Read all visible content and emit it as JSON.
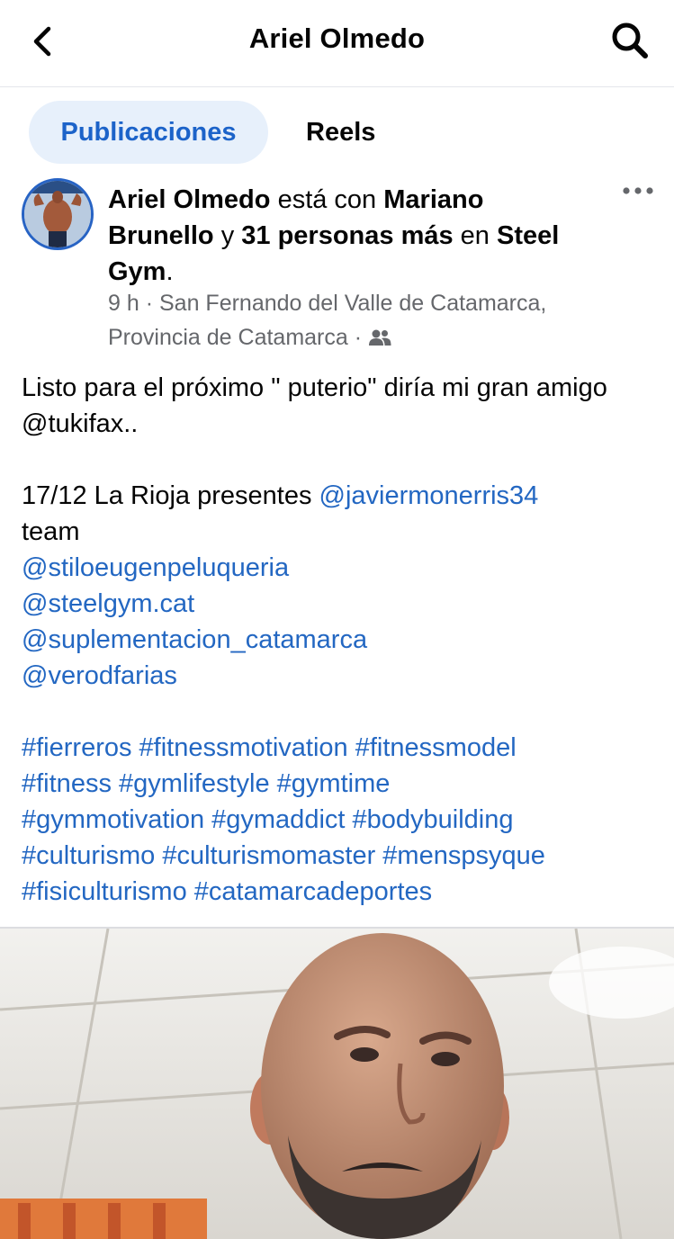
{
  "header": {
    "title": "Ariel Olmedo",
    "back_icon": "chevron-left-icon",
    "search_icon": "search-icon"
  },
  "tabs": [
    {
      "label": "Publicaciones",
      "active": true
    },
    {
      "label": "Reels",
      "active": false
    }
  ],
  "post": {
    "author": "Ariel Olmedo",
    "with_text": "está con",
    "tagged": "Mariano Brunello",
    "connector": "y",
    "others": "31 personas más",
    "in_text": "en",
    "place": "Steel Gym",
    "period": ".",
    "time": "9 h",
    "dot": "·",
    "location": "San Fernando del Valle de Catamarca, Provincia de Catamarca",
    "audience_icon": "friends-icon",
    "more_icon": "more-horizontal-icon",
    "body_line1": "Listo para el próximo \" puterio\" diría mi gran amigo @tukifax..",
    "body_line2_text": "17/12 La Rioja presentes",
    "body_line2_mention": "@javiermonerris34",
    "body_line3": "team",
    "mentions": [
      "@stiloeugenpeluqueria",
      "@steelgym.cat",
      "@suplementacion_catamarca",
      "@verodfarias"
    ],
    "hashtag_lines": [
      "#fierreros #fitnessmotivation #fitnessmodel",
      "#fitness #gymlifestyle #gymtime",
      "#gymmotivation #gymaddict #bodybuilding",
      "#culturismo #culturismomaster #menspsyque",
      "#fisiculturismo #catamarcadeportes"
    ]
  },
  "colors": {
    "link": "#2367c2",
    "tab_active_bg": "#e7f0fb",
    "tab_active_text": "#1c63c9",
    "meta": "#65676b"
  }
}
